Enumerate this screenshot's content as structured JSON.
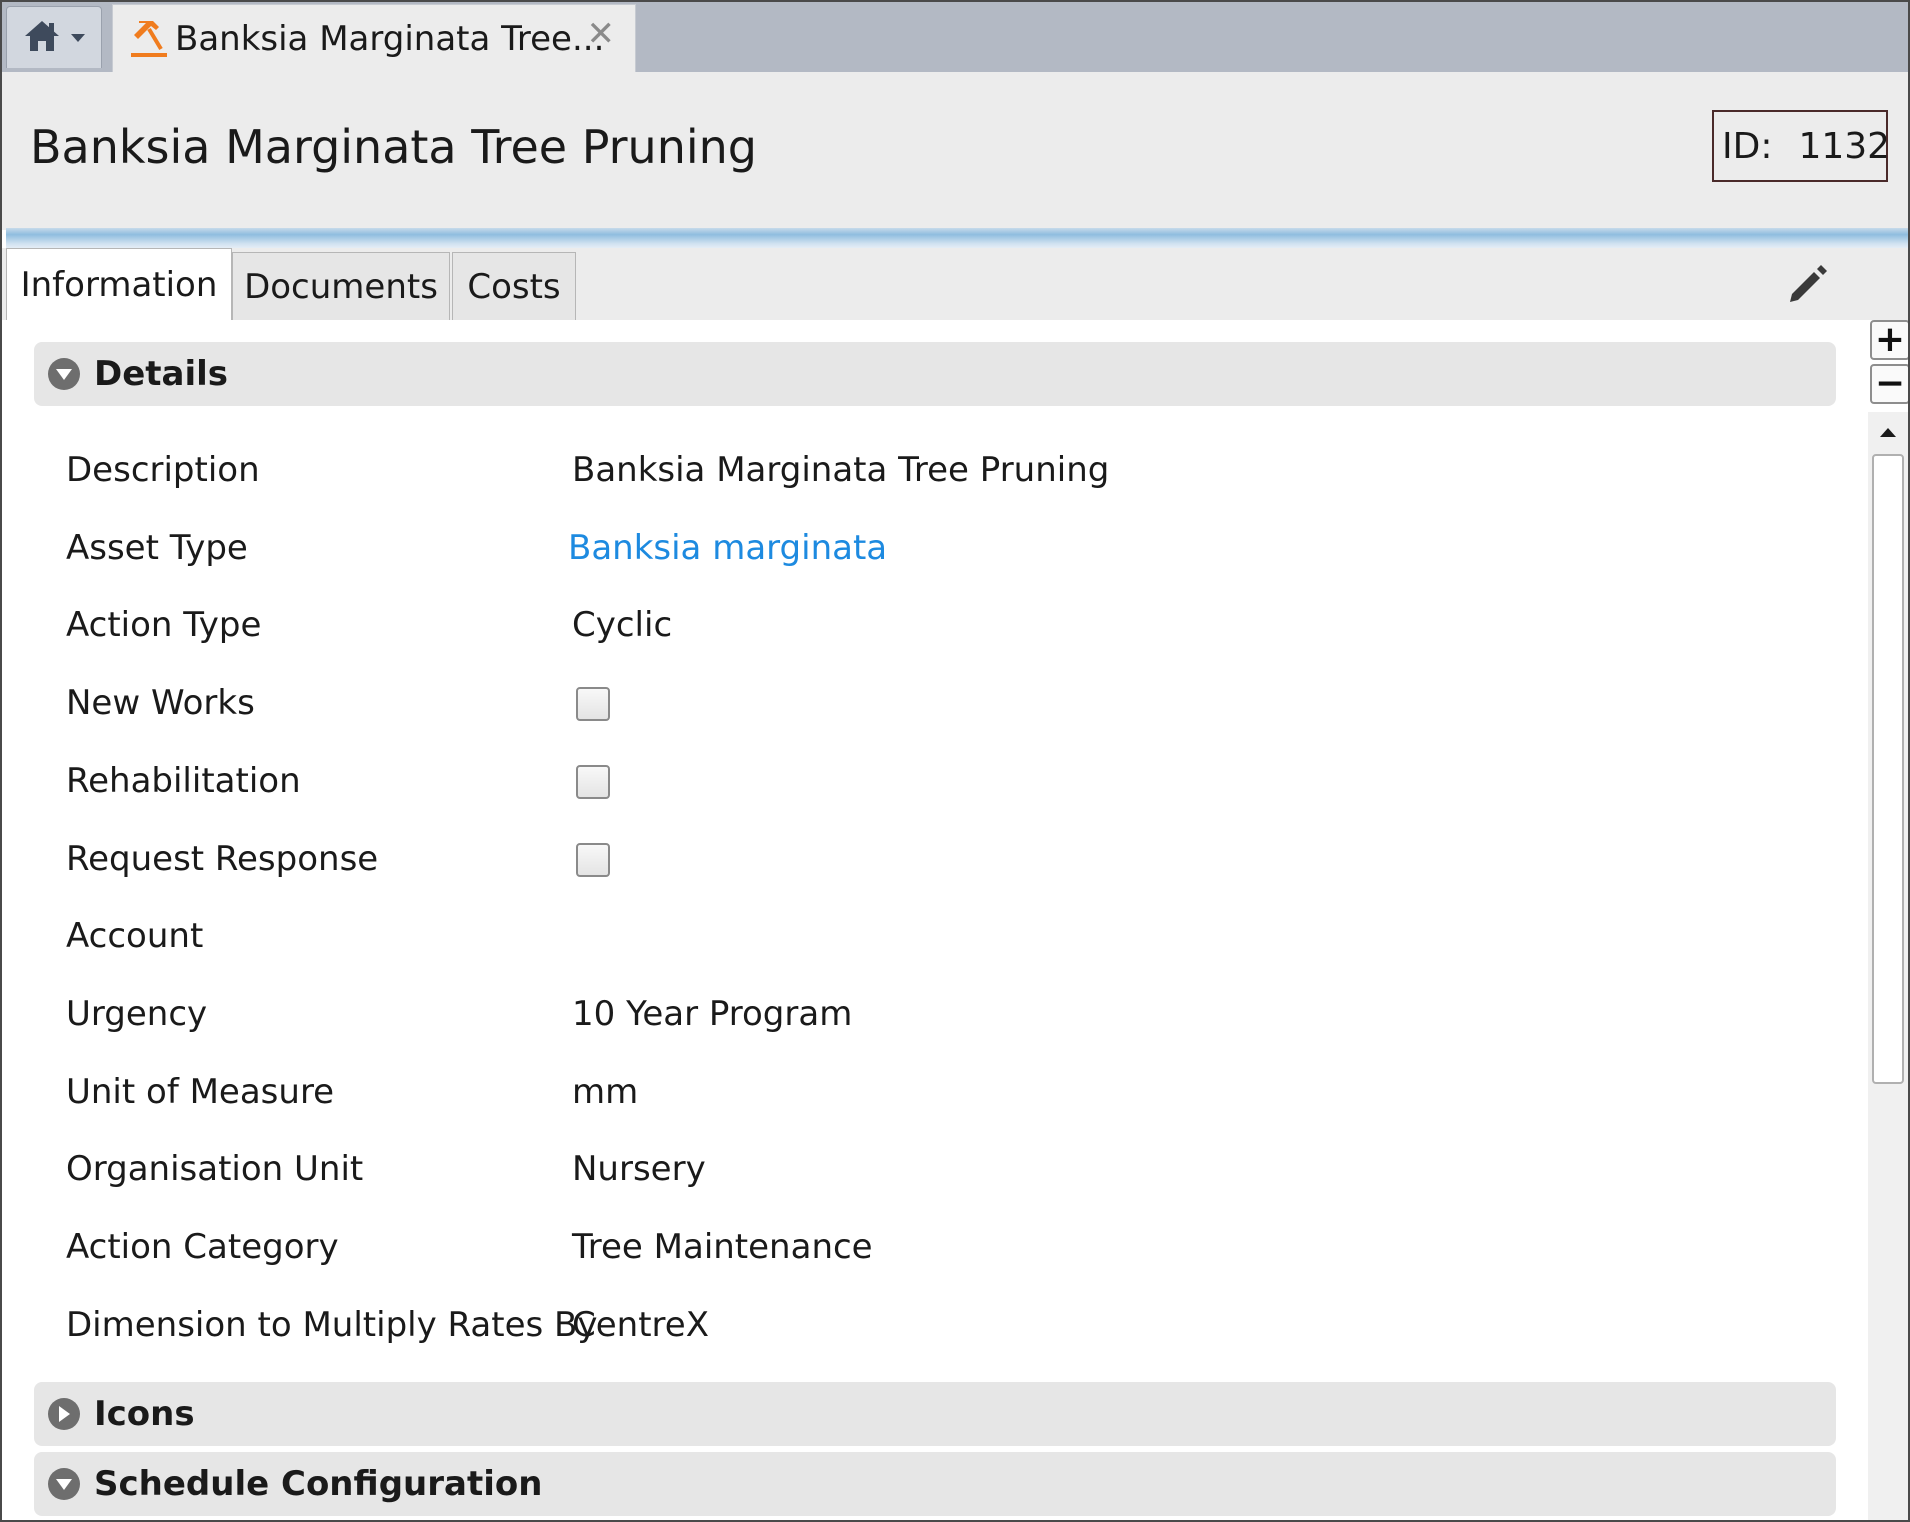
{
  "window": {
    "home_icon": "home-icon",
    "doc_tab_icon": "hammer-icon",
    "doc_tab_title": "Banksia Marginata Tree...",
    "doc_tab_close": "✕"
  },
  "header": {
    "title": "Banksia Marginata Tree Pruning",
    "id_label": "ID:",
    "id_value": "1132"
  },
  "tabs": [
    {
      "label": "Information",
      "active": true
    },
    {
      "label": "Documents",
      "active": false
    },
    {
      "label": "Costs",
      "active": false
    }
  ],
  "sections": {
    "details": {
      "title": "Details",
      "expanded": true,
      "fields": [
        {
          "label": "Description",
          "value": "Banksia Marginata Tree Pruning"
        },
        {
          "label": "Asset Type",
          "value": "Banksia marginata"
        },
        {
          "label": "Action Type",
          "value": "Cyclic"
        },
        {
          "label": "New Works",
          "checked": false
        },
        {
          "label": "Rehabilitation",
          "checked": false
        },
        {
          "label": "Request Response",
          "checked": false
        },
        {
          "label": "Account",
          "value": ""
        },
        {
          "label": "Urgency",
          "value": "10 Year Program"
        },
        {
          "label": "Unit of Measure",
          "value": "mm"
        },
        {
          "label": "Organisation Unit",
          "value": "Nursery"
        },
        {
          "label": "Action Category",
          "value": "Tree Maintenance"
        },
        {
          "label": "Dimension to Multiply Rates By",
          "value": "CentreX"
        }
      ]
    },
    "icons": {
      "title": "Icons",
      "expanded": false
    },
    "schedule": {
      "title": "Schedule Configuration",
      "expanded": true
    }
  },
  "controls": {
    "zoom_in": "+",
    "zoom_out": "−"
  },
  "colors": {
    "link": "#1d8ae0",
    "tab_icon": "#f07c1e",
    "header_bg": "#ececec",
    "section_bg": "#e6e6e6"
  }
}
